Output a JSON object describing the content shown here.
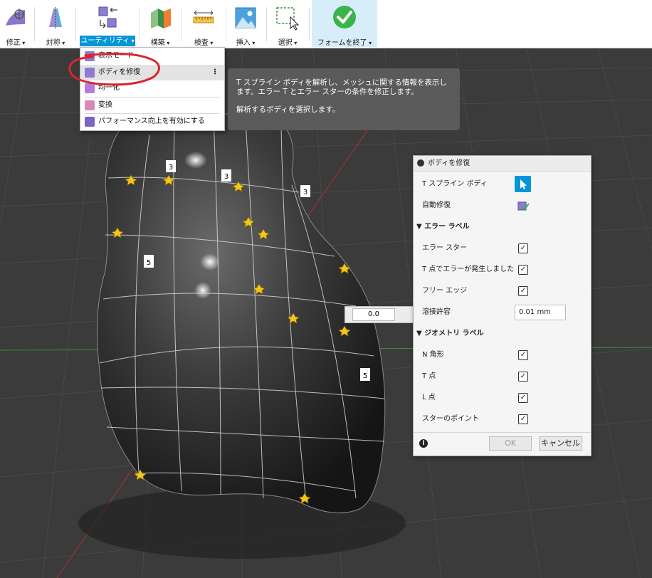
{
  "toolbar": {
    "modify": "修正",
    "symmetry": "対称",
    "utility": "ユーティリティ",
    "construct": "構築",
    "inspect": "検査",
    "insert": "挿入",
    "select": "選択",
    "finish_form": "フォームを終了"
  },
  "utility_menu": {
    "items": [
      "表示モード",
      "ボディを修復",
      "均一化",
      "変換",
      "パフォーマンス向上を有効にする"
    ],
    "highlighted_index": 1
  },
  "tooltip": {
    "line1": "T スプライン ボディを解析し、メッシュに関する情報を表示します。エラー T とエラー スターの条件を修正します。",
    "line2": "解析するボディを選択します。"
  },
  "dialog": {
    "title": "ボディを修復",
    "tspline_body": "T スプライン ボディ",
    "auto_repair": "自動修復",
    "error_labels_group": "エラー ラベル",
    "error_star": "エラー スター",
    "t_point_error": "T 点でエラーが発生しました",
    "free_edge": "フリー エッジ",
    "weld_tolerance": "溶接許容",
    "weld_tolerance_value": "0.01 mm",
    "geometry_labels_group": "ジオメトリ ラベル",
    "n_gon": "N 角形",
    "t_point": "T 点",
    "l_point": "L 点",
    "star_point": "スターのポイント",
    "ok": "OK",
    "cancel": "キャンセル",
    "checked": {
      "error_star": true,
      "t_point_error": true,
      "free_edge": true,
      "n_gon": true,
      "t_point": true,
      "l_point": true,
      "star_point": true
    }
  },
  "viewport": {
    "value_box": "0.0",
    "labels": [
      "3",
      "3",
      "3",
      "5",
      "5"
    ]
  },
  "colors": {
    "accent": "#0696d7",
    "finish_green": "#3ab54a",
    "annotation_red": "#d9262b",
    "star_yellow": "#f5c518"
  }
}
